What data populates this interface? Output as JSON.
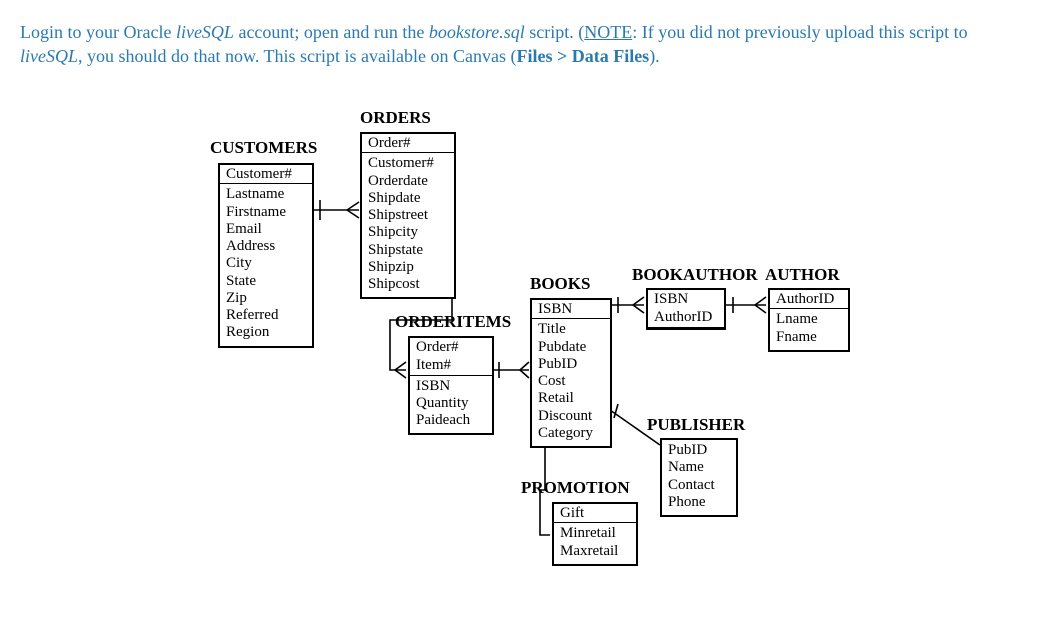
{
  "instruction": {
    "t1": "Login to your Oracle ",
    "t2": "liveSQL",
    "t3": " account; open and run the ",
    "t4": "bookstore.sql",
    "t5": " script. (",
    "t6": "NOTE",
    "t7": ": If you did not previously upload this script to ",
    "t8": "liveSQL",
    "t9": ", you should do that now. This script is available on Canvas (",
    "t10": "Files > Data Files",
    "t11": ")."
  },
  "tables": {
    "customers": {
      "name": "CUSTOMERS",
      "pk": "Customer#",
      "fields": {
        "f1": "Lastname",
        "f2": "Firstname",
        "f3": "Email",
        "f4": "Address",
        "f5": "City",
        "f6": "State",
        "f7": "Zip",
        "f8": "Referred",
        "f9": "Region"
      }
    },
    "orders": {
      "name": "ORDERS",
      "pk": "Order#",
      "fields": {
        "f1": "Customer#",
        "f2": "Orderdate",
        "f3": "Shipdate",
        "f4": "Shipstreet",
        "f5": "Shipcity",
        "f6": "Shipstate",
        "f7": "Shipzip",
        "f8": "Shipcost"
      }
    },
    "orderitems": {
      "name": "ORDERITEMS",
      "pk": "Order#",
      "pk2": "Item#",
      "fields": {
        "f1": "ISBN",
        "f2": "Quantity",
        "f3": "Paideach"
      }
    },
    "books": {
      "name": "BOOKS",
      "pk": "ISBN",
      "fields": {
        "f1": "Title",
        "f2": "Pubdate",
        "f3": "PubID",
        "f4": "Cost",
        "f5": "Retail",
        "f6": "Discount",
        "f7": "Category"
      }
    },
    "bookauthor": {
      "name": "BOOKAUTHOR",
      "pk": "ISBN",
      "pk2": "AuthorID",
      "fields": {}
    },
    "author": {
      "name": "AUTHOR",
      "pk": "AuthorID",
      "fields": {
        "f1": "Lname",
        "f2": "Fname"
      }
    },
    "publisher": {
      "name": "PUBLISHER",
      "fields": {
        "f1": "PubID",
        "f2": "Name",
        "f3": "Contact",
        "f4": "Phone"
      }
    },
    "promotion": {
      "name": "PROMOTION",
      "pk": "Gift",
      "fields": {
        "f1": "Minretail",
        "f2": "Maxretail"
      }
    }
  },
  "relations": [
    "CUSTOMERS→ORDERS",
    "ORDERS→ORDERITEMS",
    "ORDERITEMS→BOOKS",
    "BOOKS→BOOKAUTHOR",
    "BOOKAUTHOR→AUTHOR",
    "BOOKS→PUBLISHER",
    "BOOKS→PROMOTION"
  ]
}
